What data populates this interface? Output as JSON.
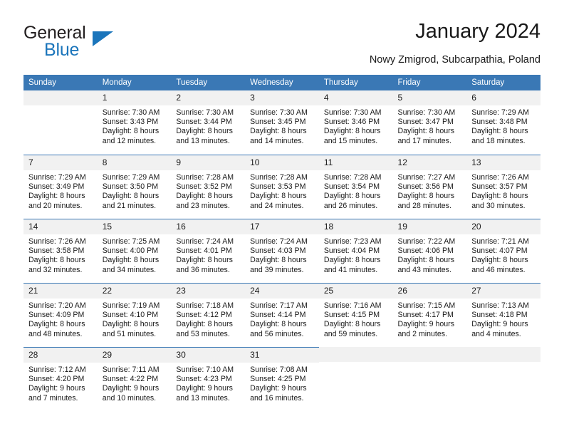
{
  "brand": {
    "word_one": "General",
    "word_two": "Blue",
    "accent_color": "#1b75bb"
  },
  "header": {
    "title": "January 2024",
    "location": "Nowy Zmigrod, Subcarpathia, Poland"
  },
  "theme": {
    "header_bg": "#3a78b5",
    "daynum_bg": "#f1f1f1",
    "rule_color": "#3a78b5"
  },
  "weekday_headers": [
    "Sunday",
    "Monday",
    "Tuesday",
    "Wednesday",
    "Thursday",
    "Friday",
    "Saturday"
  ],
  "weeks": [
    [
      {
        "day": "",
        "sunrise": "",
        "sunset": "",
        "daylight1": "",
        "daylight2": ""
      },
      {
        "day": "1",
        "sunrise": "Sunrise: 7:30 AM",
        "sunset": "Sunset: 3:43 PM",
        "daylight1": "Daylight: 8 hours",
        "daylight2": "and 12 minutes."
      },
      {
        "day": "2",
        "sunrise": "Sunrise: 7:30 AM",
        "sunset": "Sunset: 3:44 PM",
        "daylight1": "Daylight: 8 hours",
        "daylight2": "and 13 minutes."
      },
      {
        "day": "3",
        "sunrise": "Sunrise: 7:30 AM",
        "sunset": "Sunset: 3:45 PM",
        "daylight1": "Daylight: 8 hours",
        "daylight2": "and 14 minutes."
      },
      {
        "day": "4",
        "sunrise": "Sunrise: 7:30 AM",
        "sunset": "Sunset: 3:46 PM",
        "daylight1": "Daylight: 8 hours",
        "daylight2": "and 15 minutes."
      },
      {
        "day": "5",
        "sunrise": "Sunrise: 7:30 AM",
        "sunset": "Sunset: 3:47 PM",
        "daylight1": "Daylight: 8 hours",
        "daylight2": "and 17 minutes."
      },
      {
        "day": "6",
        "sunrise": "Sunrise: 7:29 AM",
        "sunset": "Sunset: 3:48 PM",
        "daylight1": "Daylight: 8 hours",
        "daylight2": "and 18 minutes."
      }
    ],
    [
      {
        "day": "7",
        "sunrise": "Sunrise: 7:29 AM",
        "sunset": "Sunset: 3:49 PM",
        "daylight1": "Daylight: 8 hours",
        "daylight2": "and 20 minutes."
      },
      {
        "day": "8",
        "sunrise": "Sunrise: 7:29 AM",
        "sunset": "Sunset: 3:50 PM",
        "daylight1": "Daylight: 8 hours",
        "daylight2": "and 21 minutes."
      },
      {
        "day": "9",
        "sunrise": "Sunrise: 7:28 AM",
        "sunset": "Sunset: 3:52 PM",
        "daylight1": "Daylight: 8 hours",
        "daylight2": "and 23 minutes."
      },
      {
        "day": "10",
        "sunrise": "Sunrise: 7:28 AM",
        "sunset": "Sunset: 3:53 PM",
        "daylight1": "Daylight: 8 hours",
        "daylight2": "and 24 minutes."
      },
      {
        "day": "11",
        "sunrise": "Sunrise: 7:28 AM",
        "sunset": "Sunset: 3:54 PM",
        "daylight1": "Daylight: 8 hours",
        "daylight2": "and 26 minutes."
      },
      {
        "day": "12",
        "sunrise": "Sunrise: 7:27 AM",
        "sunset": "Sunset: 3:56 PM",
        "daylight1": "Daylight: 8 hours",
        "daylight2": "and 28 minutes."
      },
      {
        "day": "13",
        "sunrise": "Sunrise: 7:26 AM",
        "sunset": "Sunset: 3:57 PM",
        "daylight1": "Daylight: 8 hours",
        "daylight2": "and 30 minutes."
      }
    ],
    [
      {
        "day": "14",
        "sunrise": "Sunrise: 7:26 AM",
        "sunset": "Sunset: 3:58 PM",
        "daylight1": "Daylight: 8 hours",
        "daylight2": "and 32 minutes."
      },
      {
        "day": "15",
        "sunrise": "Sunrise: 7:25 AM",
        "sunset": "Sunset: 4:00 PM",
        "daylight1": "Daylight: 8 hours",
        "daylight2": "and 34 minutes."
      },
      {
        "day": "16",
        "sunrise": "Sunrise: 7:24 AM",
        "sunset": "Sunset: 4:01 PM",
        "daylight1": "Daylight: 8 hours",
        "daylight2": "and 36 minutes."
      },
      {
        "day": "17",
        "sunrise": "Sunrise: 7:24 AM",
        "sunset": "Sunset: 4:03 PM",
        "daylight1": "Daylight: 8 hours",
        "daylight2": "and 39 minutes."
      },
      {
        "day": "18",
        "sunrise": "Sunrise: 7:23 AM",
        "sunset": "Sunset: 4:04 PM",
        "daylight1": "Daylight: 8 hours",
        "daylight2": "and 41 minutes."
      },
      {
        "day": "19",
        "sunrise": "Sunrise: 7:22 AM",
        "sunset": "Sunset: 4:06 PM",
        "daylight1": "Daylight: 8 hours",
        "daylight2": "and 43 minutes."
      },
      {
        "day": "20",
        "sunrise": "Sunrise: 7:21 AM",
        "sunset": "Sunset: 4:07 PM",
        "daylight1": "Daylight: 8 hours",
        "daylight2": "and 46 minutes."
      }
    ],
    [
      {
        "day": "21",
        "sunrise": "Sunrise: 7:20 AM",
        "sunset": "Sunset: 4:09 PM",
        "daylight1": "Daylight: 8 hours",
        "daylight2": "and 48 minutes."
      },
      {
        "day": "22",
        "sunrise": "Sunrise: 7:19 AM",
        "sunset": "Sunset: 4:10 PM",
        "daylight1": "Daylight: 8 hours",
        "daylight2": "and 51 minutes."
      },
      {
        "day": "23",
        "sunrise": "Sunrise: 7:18 AM",
        "sunset": "Sunset: 4:12 PM",
        "daylight1": "Daylight: 8 hours",
        "daylight2": "and 53 minutes."
      },
      {
        "day": "24",
        "sunrise": "Sunrise: 7:17 AM",
        "sunset": "Sunset: 4:14 PM",
        "daylight1": "Daylight: 8 hours",
        "daylight2": "and 56 minutes."
      },
      {
        "day": "25",
        "sunrise": "Sunrise: 7:16 AM",
        "sunset": "Sunset: 4:15 PM",
        "daylight1": "Daylight: 8 hours",
        "daylight2": "and 59 minutes."
      },
      {
        "day": "26",
        "sunrise": "Sunrise: 7:15 AM",
        "sunset": "Sunset: 4:17 PM",
        "daylight1": "Daylight: 9 hours",
        "daylight2": "and 2 minutes."
      },
      {
        "day": "27",
        "sunrise": "Sunrise: 7:13 AM",
        "sunset": "Sunset: 4:18 PM",
        "daylight1": "Daylight: 9 hours",
        "daylight2": "and 4 minutes."
      }
    ],
    [
      {
        "day": "28",
        "sunrise": "Sunrise: 7:12 AM",
        "sunset": "Sunset: 4:20 PM",
        "daylight1": "Daylight: 9 hours",
        "daylight2": "and 7 minutes."
      },
      {
        "day": "29",
        "sunrise": "Sunrise: 7:11 AM",
        "sunset": "Sunset: 4:22 PM",
        "daylight1": "Daylight: 9 hours",
        "daylight2": "and 10 minutes."
      },
      {
        "day": "30",
        "sunrise": "Sunrise: 7:10 AM",
        "sunset": "Sunset: 4:23 PM",
        "daylight1": "Daylight: 9 hours",
        "daylight2": "and 13 minutes."
      },
      {
        "day": "31",
        "sunrise": "Sunrise: 7:08 AM",
        "sunset": "Sunset: 4:25 PM",
        "daylight1": "Daylight: 9 hours",
        "daylight2": "and 16 minutes."
      },
      {
        "day": "",
        "sunrise": "",
        "sunset": "",
        "daylight1": "",
        "daylight2": ""
      },
      {
        "day": "",
        "sunrise": "",
        "sunset": "",
        "daylight1": "",
        "daylight2": ""
      },
      {
        "day": "",
        "sunrise": "",
        "sunset": "",
        "daylight1": "",
        "daylight2": ""
      }
    ]
  ]
}
